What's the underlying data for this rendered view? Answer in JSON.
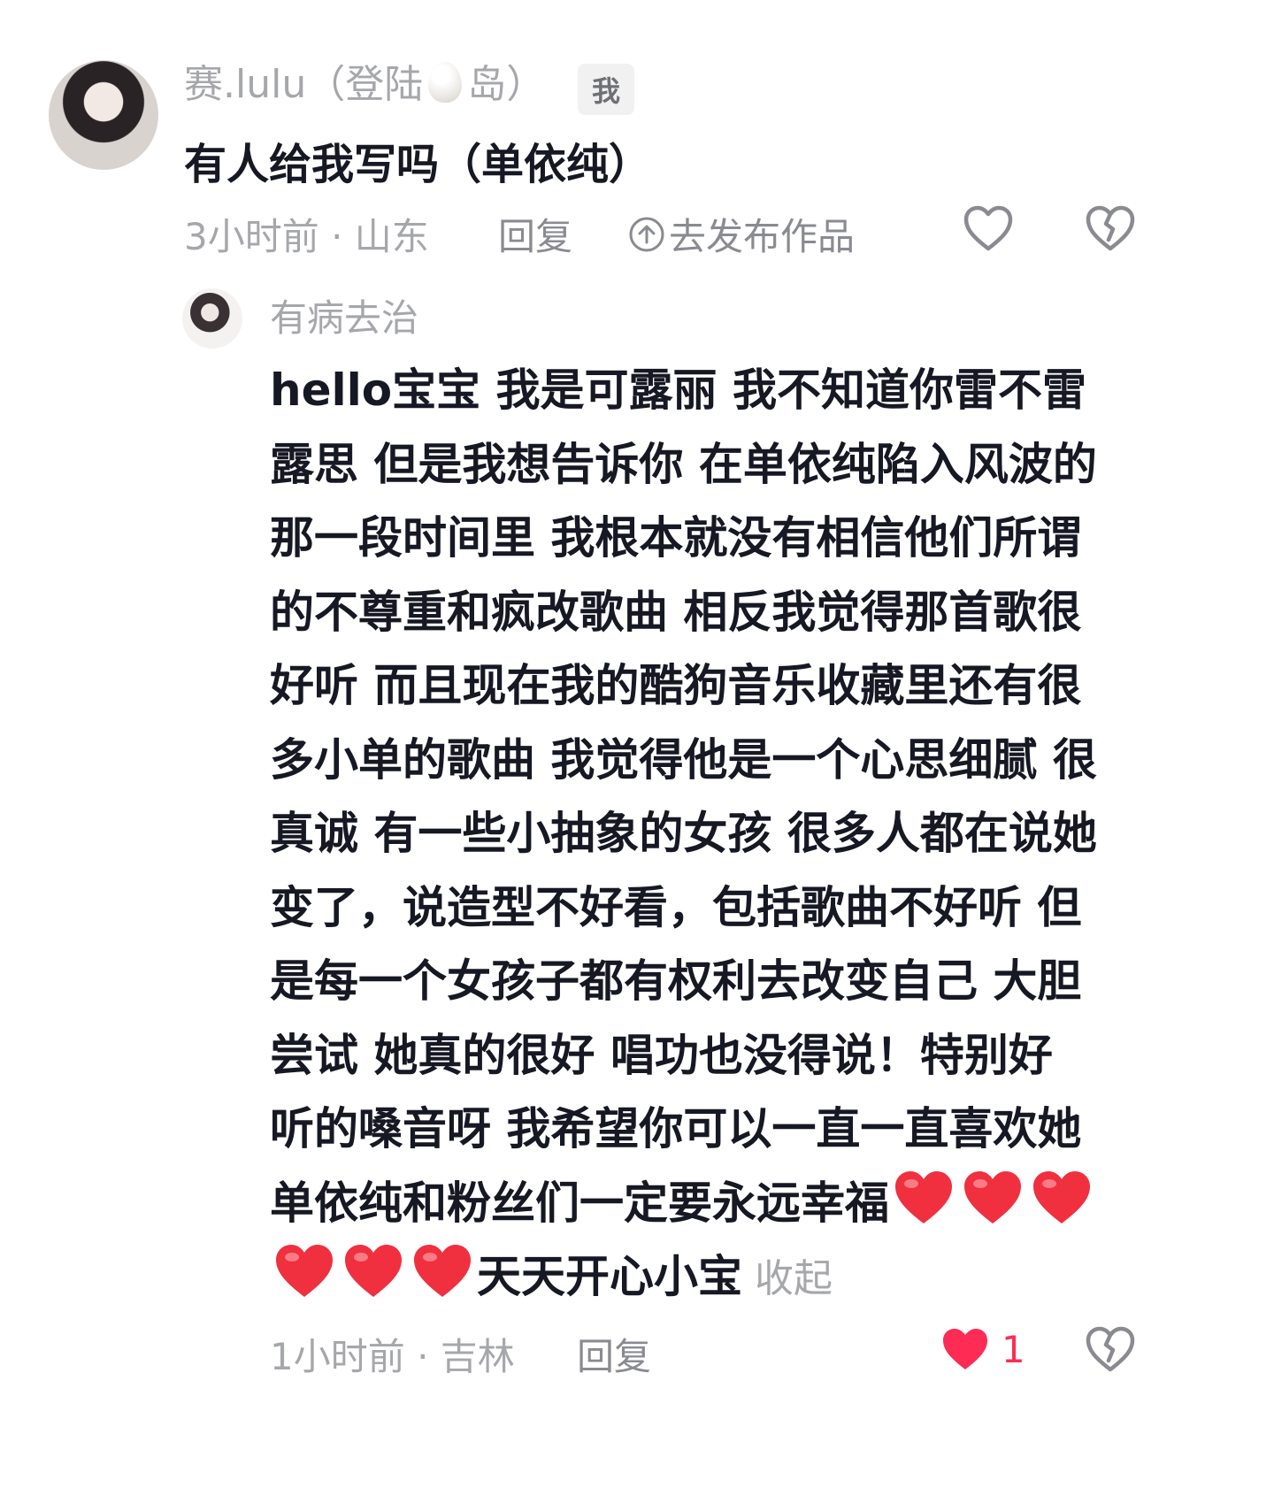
{
  "comment": {
    "author": "赛.lulu（登陆",
    "author_suffix": "岛）",
    "me_tag": "我",
    "text": "有人给我写吗（单依纯）",
    "time_location": "3小时前 · 山东",
    "reply_label": "回复",
    "publish_label": "去发布作品"
  },
  "reply": {
    "author": "有病去治",
    "lines": [
      "hello宝宝  我是可露丽  我不知道你雷不雷",
      "露思  但是我想告诉你  在单依纯陷入风波的",
      "那一段时间里  我根本就没有相信他们所谓",
      "的不尊重和疯改歌曲  相反我觉得那首歌很",
      "好听  而且现在我的酷狗音乐收藏里还有很",
      "多小单的歌曲  我觉得他是一个心思细腻  很",
      "真诚  有一些小抽象的女孩  很多人都在说她",
      "变了，说造型不好看，包括歌曲不好听  但",
      "是每一个女孩子都有权利去改变自己  大胆",
      "尝试  她真的很好  唱功也没得说！特别好",
      "听的嗓音呀  我希望你可以一直一直喜欢她"
    ],
    "line_12": "单依纯和粉丝们一定要永远幸福",
    "line_13": "天天开心小宝",
    "collapse_label": "收起",
    "time_location": "1小时前 · 吉林",
    "reply_label": "回复",
    "like_count": "1",
    "colors": {
      "liked_heart": "#fe2c55",
      "emoji_heart": "#f0303f"
    }
  }
}
